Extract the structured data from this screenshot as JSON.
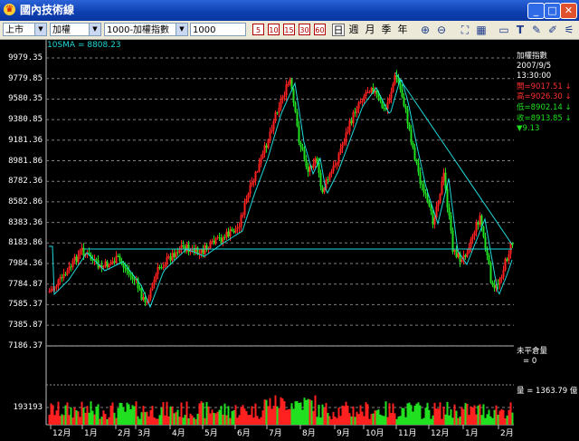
{
  "window": {
    "title": "國內技術線",
    "minimize": "_",
    "maximize": "□",
    "close": "✕"
  },
  "toolbar": {
    "market": "上市",
    "stock": "加權",
    "index": "1000-加權指數",
    "value": "1000",
    "periods": [
      "5",
      "10",
      "15",
      "30",
      "60"
    ],
    "period_words": [
      "日",
      "週",
      "月",
      "季",
      "年"
    ],
    "active_period": "日"
  },
  "chart": {
    "sma_label": "10SMA = 8808.23",
    "y_ticks": [
      "9979.35",
      "9779.85",
      "9580.35",
      "9380.85",
      "9181.36",
      "8981.86",
      "8782.36",
      "8582.86",
      "8383.36",
      "8183.86",
      "7984.36",
      "7784.87",
      "7585.37",
      "7385.87",
      "7186.37"
    ],
    "x_ticks": [
      "12月",
      "1月",
      "2月",
      "3月",
      "4月",
      "5月",
      "6月",
      "7月",
      "8月",
      "9月",
      "10月",
      "11月",
      "12月",
      "1月",
      "2月"
    ],
    "info": {
      "name": "加權指數",
      "date": "2007/9/5",
      "time": "13:30:00",
      "open": "開=9017.51 ↓",
      "high": "高=9026.30 ↓",
      "low": "低=8902.14 ↓",
      "close": "收=8913.85 ↓",
      "change": "▼9.13"
    },
    "unbalanced_label": "未平倉量",
    "unbalanced_value": "= 0",
    "volume_label": "量 = 1363.79 億",
    "volume_tick": "193193",
    "colors": {
      "up": "#ff2020",
      "down": "#20e020",
      "sma": "#20d8d8",
      "grid": "#808080"
    }
  }
}
